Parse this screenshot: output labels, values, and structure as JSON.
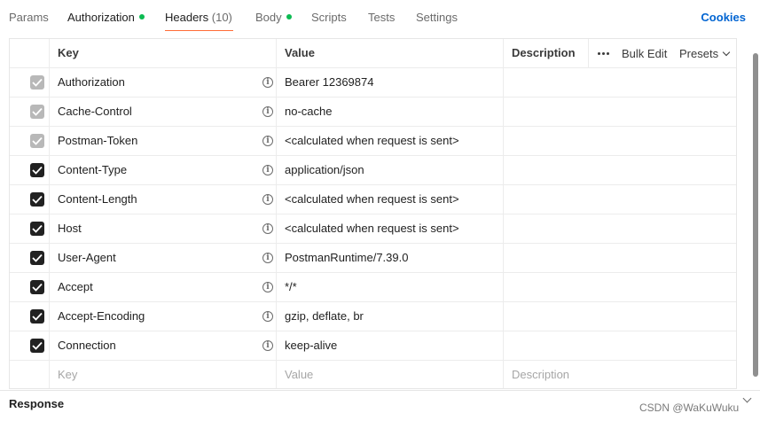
{
  "tabs": [
    {
      "label": "Params",
      "dot": false
    },
    {
      "label": "Authorization",
      "dot": true
    },
    {
      "label": "Headers",
      "count": "(10)",
      "active": true
    },
    {
      "label": "Body",
      "dot": true
    },
    {
      "label": "Scripts"
    },
    {
      "label": "Tests"
    },
    {
      "label": "Settings"
    }
  ],
  "cookies_label": "Cookies",
  "table": {
    "col_key": "Key",
    "col_value": "Value",
    "col_description": "Description",
    "bulk_edit": "Bulk Edit",
    "presets": "Presets",
    "rows": [
      {
        "key": "Authorization",
        "value": "Bearer 12369874",
        "checked": true,
        "disabled": true
      },
      {
        "key": "Cache-Control",
        "value": "no-cache",
        "checked": true,
        "disabled": true
      },
      {
        "key": "Postman-Token",
        "value": "<calculated when request is sent>",
        "checked": true,
        "disabled": true
      },
      {
        "key": "Content-Type",
        "value": "application/json",
        "checked": true,
        "disabled": false
      },
      {
        "key": "Content-Length",
        "value": "<calculated when request is sent>",
        "checked": true,
        "disabled": false
      },
      {
        "key": "Host",
        "value": "<calculated when request is sent>",
        "checked": true,
        "disabled": false
      },
      {
        "key": "User-Agent",
        "value": "PostmanRuntime/7.39.0",
        "checked": true,
        "disabled": false
      },
      {
        "key": "Accept",
        "value": "*/*",
        "checked": true,
        "disabled": false
      },
      {
        "key": "Accept-Encoding",
        "value": "gzip, deflate, br",
        "checked": true,
        "disabled": false
      },
      {
        "key": "Connection",
        "value": "keep-alive",
        "checked": true,
        "disabled": false
      }
    ],
    "new_row": {
      "key_placeholder": "Key",
      "value_placeholder": "Value",
      "description_placeholder": "Description"
    }
  },
  "response_label": "Response",
  "watermark": "CSDN @WaKuWuku",
  "colors": {
    "accent": "#ff6c37",
    "dot": "#0cbb52",
    "link": "#0265d2"
  }
}
